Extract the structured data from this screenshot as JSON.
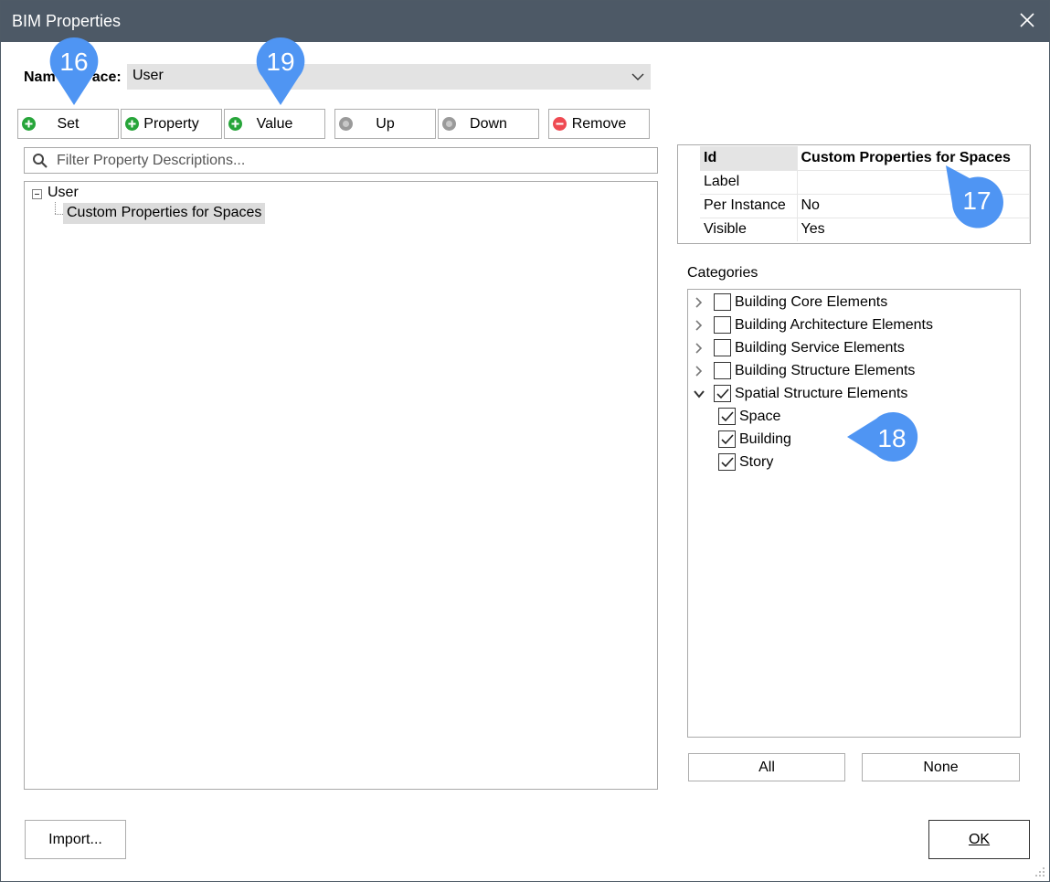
{
  "window": {
    "title": "BIM Properties"
  },
  "namespace": {
    "label": "Namespace:",
    "label_visible_start": "Nam",
    "label_visible_end": "ace:",
    "value": "User"
  },
  "toolbar": [
    {
      "label": "Set",
      "icon": "plus-icon",
      "color": "#27a53a"
    },
    {
      "label": "Property",
      "icon": "plus-icon",
      "color": "#27a53a"
    },
    {
      "label": "Value",
      "icon": "plus-icon",
      "color": "#27a53a"
    },
    {
      "label": "Up",
      "icon": "up-icon",
      "color": "#9a9a9a"
    },
    {
      "label": "Down",
      "icon": "down-icon",
      "color": "#9a9a9a"
    },
    {
      "label": "Remove",
      "icon": "minus-icon",
      "color": "#ef4a52"
    }
  ],
  "filter": {
    "placeholder": "Filter Property Descriptions..."
  },
  "tree": {
    "root": "User",
    "child": "Custom Properties for Spaces"
  },
  "properties": [
    {
      "key": "Id",
      "value": "Custom Properties for Spaces"
    },
    {
      "key": "Label",
      "value": ""
    },
    {
      "key": "Per Instance",
      "value": "No"
    },
    {
      "key": "Visible",
      "value": "Yes"
    }
  ],
  "categories": {
    "label": "Categories",
    "items": [
      {
        "label": "Building Core Elements",
        "checked": false,
        "expanded": false
      },
      {
        "label": "Building Architecture Elements",
        "checked": false,
        "expanded": false
      },
      {
        "label": "Building Service Elements",
        "checked": false,
        "expanded": false
      },
      {
        "label": "Building Structure Elements",
        "checked": false,
        "expanded": false
      },
      {
        "label": "Spatial Structure Elements",
        "checked": true,
        "expanded": true
      }
    ],
    "subitems": [
      {
        "label": "Space",
        "checked": true
      },
      {
        "label": "Building",
        "checked": true
      },
      {
        "label": "Story",
        "checked": true
      }
    ],
    "all_label": "All",
    "none_label": "None"
  },
  "footer": {
    "import_label": "Import...",
    "ok_label": "OK"
  },
  "markers": [
    "16",
    "19",
    "17",
    "18"
  ],
  "colors": {
    "titlebar": "#4d5966",
    "marker": "#4f95f3"
  }
}
